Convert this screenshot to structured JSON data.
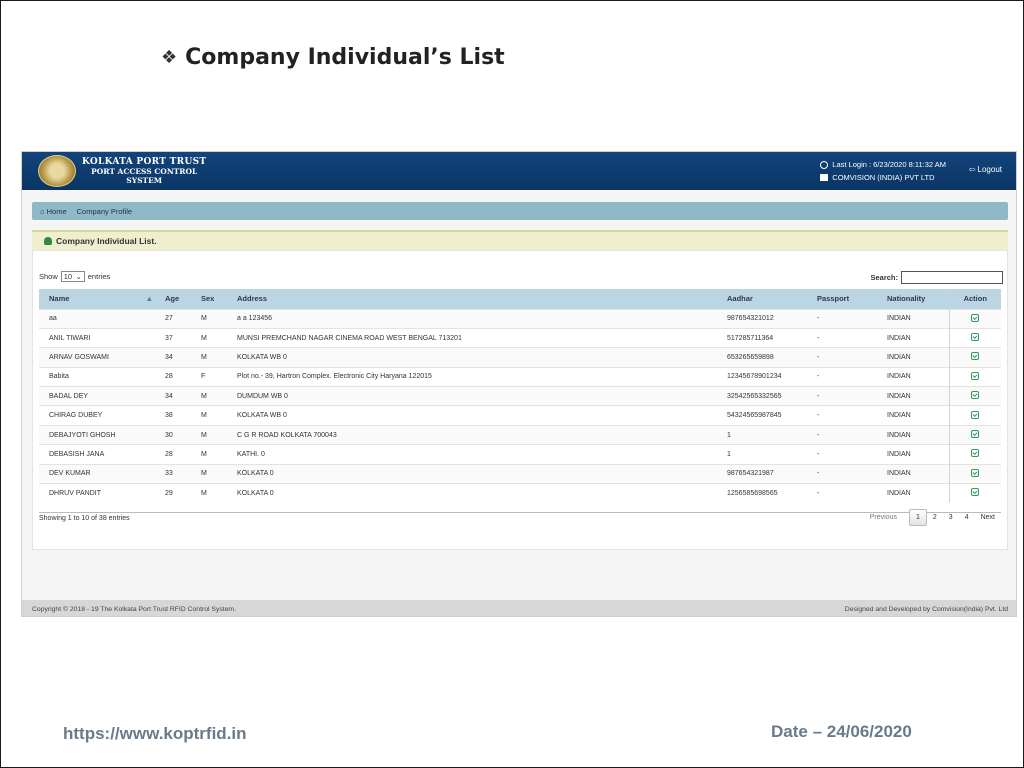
{
  "slide": {
    "title": "Company Individual’s List",
    "bullet": "❖",
    "url": "https://www.koptrfid.in",
    "date": "Date – 24/06/2020"
  },
  "header": {
    "logo_line1": "KOLKATA PORT TRUST",
    "logo_line2": "PORT ACCESS CONTROL",
    "logo_line3": "SYSTEM",
    "last_login": "Last Login : 6/23/2020 8:11:32 AM",
    "company": "COMVISION (INDIA) PVT LTD",
    "logout_label": "Logout"
  },
  "breadcrumb": {
    "home": "Home",
    "current": "Company Profile"
  },
  "panel": {
    "title": "Company Individual List."
  },
  "table_controls": {
    "show_label": "Show",
    "entries_value": "10",
    "entries_label": "entries",
    "search_label": "Search:"
  },
  "table": {
    "columns": [
      "Name",
      "Age",
      "Sex",
      "Address",
      "Aadhar",
      "Passport",
      "Nationality",
      "Action"
    ],
    "rows": [
      {
        "name": "aa",
        "age": "27",
        "sex": "M",
        "address": "a a 123456",
        "aadhar": "987654321012",
        "passport": "-",
        "nationality": "INDIAN"
      },
      {
        "name": "ANIL TIWARI",
        "age": "37",
        "sex": "M",
        "address": "MUNSI PREMCHAND NAGAR CINEMA ROAD WEST BENGAL 713201",
        "aadhar": "517285711364",
        "passport": "-",
        "nationality": "INDIAN"
      },
      {
        "name": "ARNAV GOSWAMI",
        "age": "34",
        "sex": "M",
        "address": "KOLKATA WB 0",
        "aadhar": "653265659898",
        "passport": "-",
        "nationality": "INDIAN"
      },
      {
        "name": "Babita",
        "age": "28",
        "sex": "F",
        "address": "Plot no.- 39, Hartron Complex. Electronic City Haryana 122015",
        "aadhar": "12345678901234",
        "passport": "-",
        "nationality": "INDIAN"
      },
      {
        "name": "BADAL DEY",
        "age": "34",
        "sex": "M",
        "address": "DUMDUM WB 0",
        "aadhar": "32542565332565",
        "passport": "-",
        "nationality": "INDIAN"
      },
      {
        "name": "CHIRAG DUBEY",
        "age": "38",
        "sex": "M",
        "address": "KOLKATA WB 0",
        "aadhar": "54324565987845",
        "passport": "-",
        "nationality": "INDIAN"
      },
      {
        "name": "DEBAJYOTI GHOSH",
        "age": "30",
        "sex": "M",
        "address": "C G R ROAD KOLKATA 700043",
        "aadhar": "1",
        "passport": "-",
        "nationality": "INDIAN"
      },
      {
        "name": "DEBASISH JANA",
        "age": "28",
        "sex": "M",
        "address": "KATHI. 0",
        "aadhar": "1",
        "passport": "-",
        "nationality": "INDIAN"
      },
      {
        "name": "DEV KUMAR",
        "age": "33",
        "sex": "M",
        "address": "KOLKATA 0",
        "aadhar": "987654321987",
        "passport": "-",
        "nationality": "INDIAN"
      },
      {
        "name": "DHRUV PANDIT",
        "age": "29",
        "sex": "M",
        "address": "KOLKATA 0",
        "aadhar": "1256585698565",
        "passport": "-",
        "nationality": "INDIAN"
      }
    ]
  },
  "pagination": {
    "info": "Showing 1 to 10 of 38 entries",
    "previous": "Previous",
    "pages": [
      "1",
      "2",
      "3",
      "4"
    ],
    "next": "Next"
  },
  "footer": {
    "copyright": "Copyright © 2018 - 19 The Kolkata Port Trust RFID Control System.",
    "credit": "Designed and Developed by Comvision(India) Pvt. Ltd"
  },
  "colors": {
    "header_bg": "#0b3565",
    "breadcrumb_bg": "#8fb9c9",
    "panel_head_bg": "#efefcf",
    "table_head_bg": "#bcd5e2",
    "action_icon": "#2e9b5c"
  }
}
